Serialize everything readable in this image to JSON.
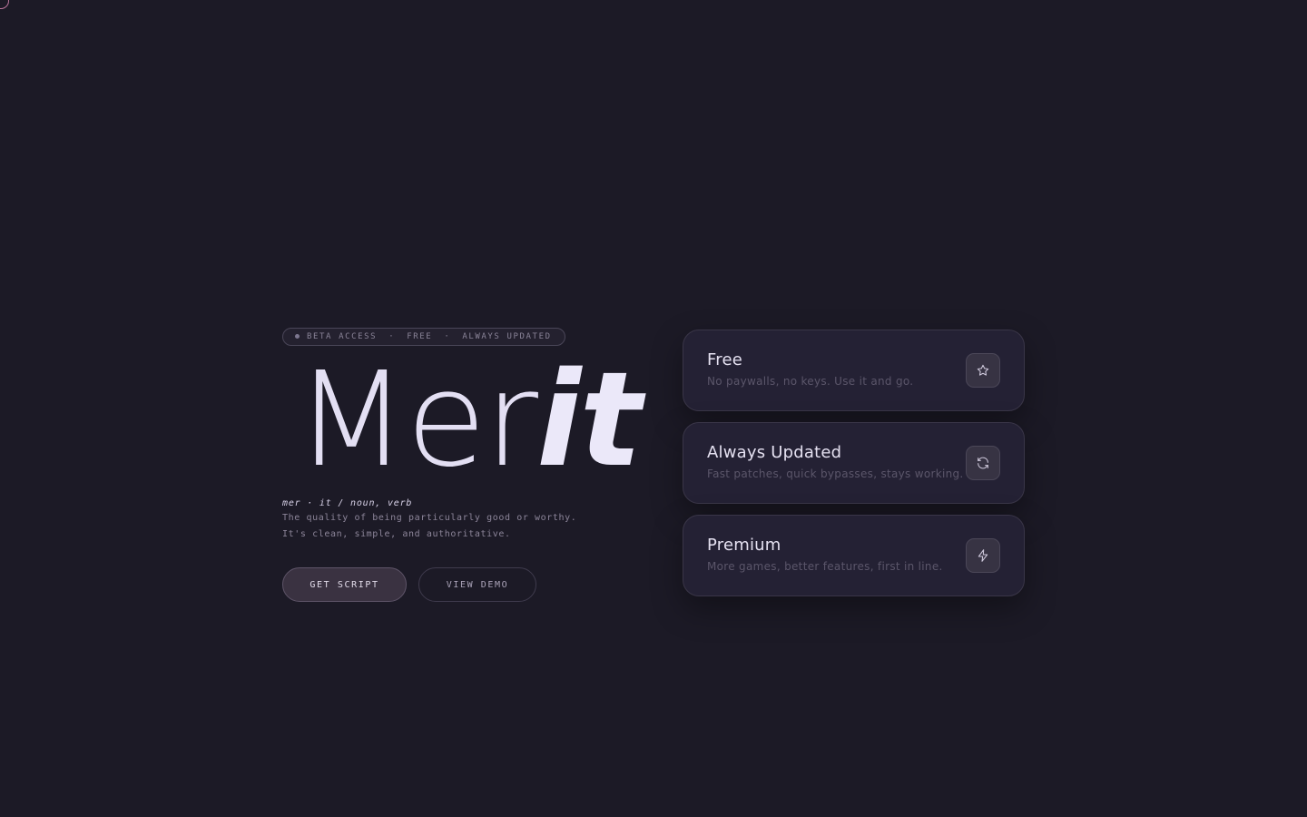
{
  "hero": {
    "badge": {
      "items": [
        "BETA ACCESS",
        "FREE",
        "ALWAYS UPDATED"
      ],
      "separator": "·"
    },
    "title_plain": "Mer",
    "title_italic": "it",
    "pronunciation": "mer · it  /  noun, verb",
    "description_lines": [
      "The quality of being particularly good or worthy.",
      "It's clean, simple, and authoritative."
    ],
    "buttons": {
      "primary": "GET SCRIPT",
      "secondary": "VIEW DEMO"
    }
  },
  "features": [
    {
      "title": "Free",
      "description": "No paywalls, no keys. Use it and go.",
      "icon": "star-icon"
    },
    {
      "title": "Always Updated",
      "description": "Fast patches, quick bypasses, stays working.",
      "icon": "refresh-icon"
    },
    {
      "title": "Premium",
      "description": "More games, better features, first in line.",
      "icon": "lightning-icon"
    }
  ],
  "colors": {
    "background": "#1c1a26",
    "card": "#242134",
    "accent_dot": "#b9749a",
    "text_primary": "#e3dff3",
    "text_muted": "#5b566a"
  }
}
